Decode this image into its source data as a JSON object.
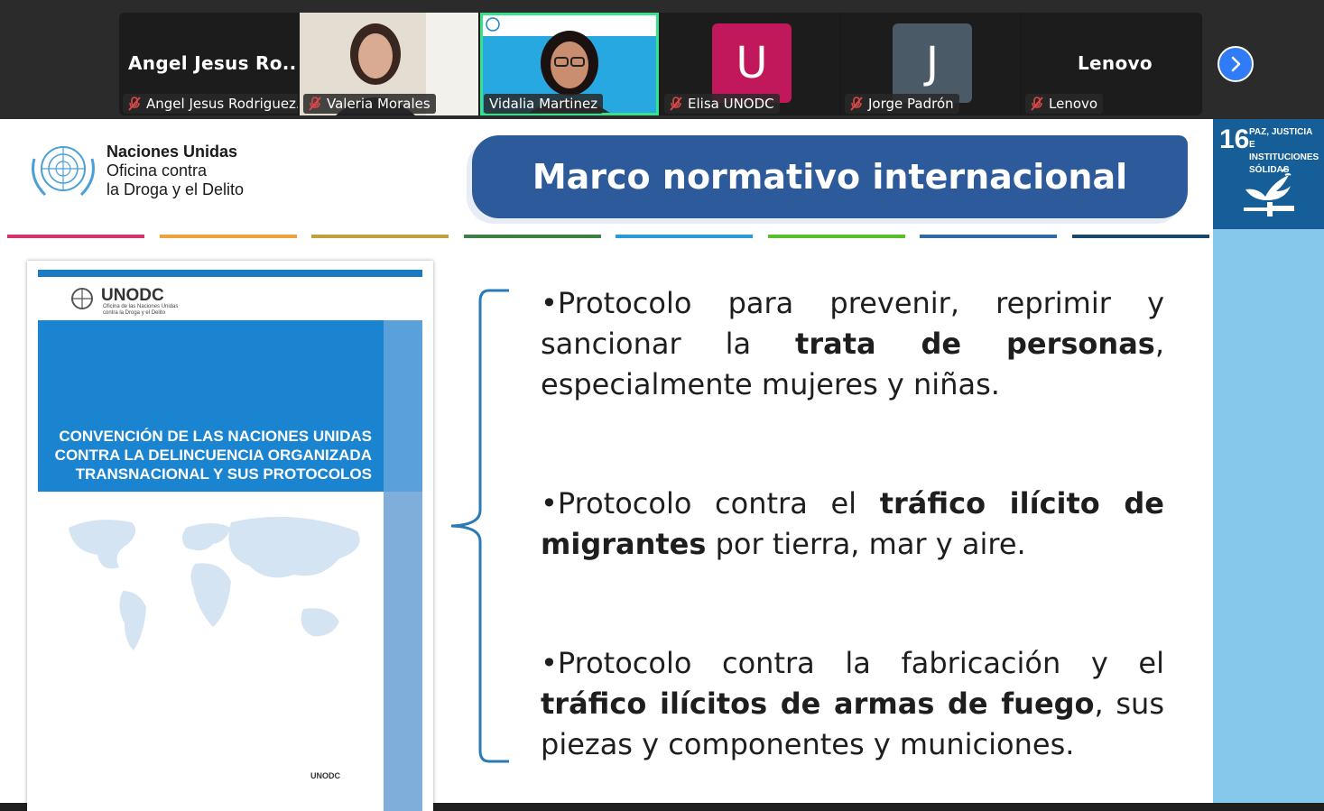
{
  "meeting": {
    "participants": [
      {
        "display": "Angel Jesus Ro...",
        "label": "Angel Jesus Rodriguez...",
        "muted": true,
        "type": "name"
      },
      {
        "label": "Valeria Morales",
        "muted": true,
        "type": "video"
      },
      {
        "label": "Vidalia Martinez",
        "muted": false,
        "type": "video",
        "active": true
      },
      {
        "initial": "U",
        "label": "Elisa UNODC",
        "muted": true,
        "type": "avatar",
        "color": "#c0185a"
      },
      {
        "initial": "J",
        "label": "Jorge Padrón",
        "muted": true,
        "type": "avatar",
        "color": "#4a5a66"
      },
      {
        "display": "Lenovo",
        "label": "Lenovo",
        "muted": true,
        "type": "name"
      }
    ],
    "next_icon": "chevron-right-icon"
  },
  "slide": {
    "org": {
      "line1": "Naciones Unidas",
      "line2": "Oficina contra",
      "line3": "la Droga y el Delito"
    },
    "title": "Marco normativo internacional",
    "sdg": {
      "number": "16",
      "line1": "PAZ, JUSTICIA",
      "line2": "E INSTITUCIONES",
      "line3": "SÓLIDAS"
    },
    "sdg_colors": [
      "#d6336c",
      "#f0a13a",
      "#c29f3f",
      "#3f7e44",
      "#2a9bd6",
      "#56c02b",
      "#2d6aa6",
      "#19486a"
    ],
    "book": {
      "brand": "UNODC",
      "brand_sub1": "Oficina de las Naciones Unidas",
      "brand_sub2": "contra la Droga y el Delito",
      "title1": "CONVENCIÓN DE LAS NACIONES UNIDAS",
      "title2": "CONTRA LA DELINCUENCIA ORGANIZADA",
      "title3": "TRANSNACIONAL Y SUS PROTOCOLOS",
      "footer_brand": "UNODC"
    },
    "points": [
      {
        "pre": "•Protocolo para prevenir, reprimir y sancionar la ",
        "bold": "trata de personas",
        "post": ", especialmente mujeres y niñas."
      },
      {
        "pre": "•Protocolo contra el ",
        "bold": "tráfico ilícito de migrantes",
        "post": " por tierra, mar y aire."
      },
      {
        "pre": "•Protocolo contra la fabricación y el ",
        "bold": "tráfico ilícitos de armas de fuego",
        "post": ", sus piezas y componentes y municiones."
      }
    ]
  }
}
